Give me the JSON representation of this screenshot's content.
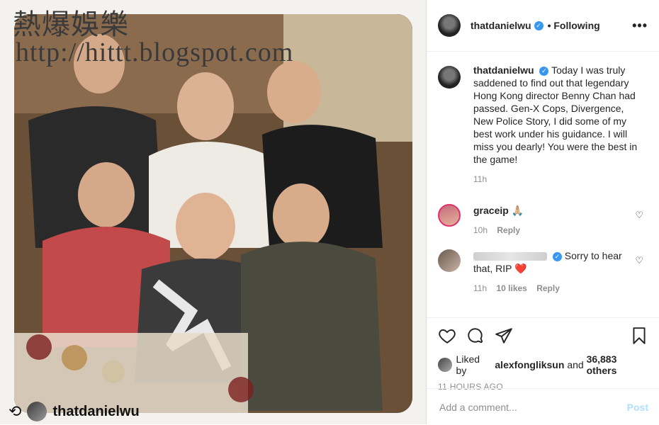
{
  "watermark": {
    "title": "熱爆娛樂",
    "url": "http://hittt.blogspot.com"
  },
  "repost": {
    "icon": "repost-icon",
    "username": "thatdanielwu"
  },
  "post": {
    "username": "thatdanielwu",
    "follow_label": "• Following",
    "caption": "Today I was truly saddened to find out that legendary Hong Kong director Benny Chan had passed. Gen-X Cops, Divergence, New Police Story, I did some of my best work under his guidance. I will miss you dearly! You were the best in the game!",
    "caption_time": "11h",
    "verified_color": "#3897f0"
  },
  "comments": [
    {
      "username": "graceip",
      "text": "🙏🏼",
      "time": "10h",
      "reply": "Reply"
    },
    {
      "username": "",
      "text": "Sorry to hear that, RIP ❤️",
      "time": "11h",
      "likes": "10 likes",
      "reply": "Reply"
    }
  ],
  "liked_by": {
    "prefix": "Liked by",
    "user": "alexfongliksun",
    "middle": "and",
    "count": "36,883 others"
  },
  "timestamp": "11 HOURS AGO",
  "add_comment": {
    "placeholder": "Add a comment...",
    "post_label": "Post"
  },
  "icons": [
    "heart-icon",
    "comment-icon",
    "share-icon",
    "bookmark-icon",
    "more-icon",
    "verified-icon"
  ]
}
